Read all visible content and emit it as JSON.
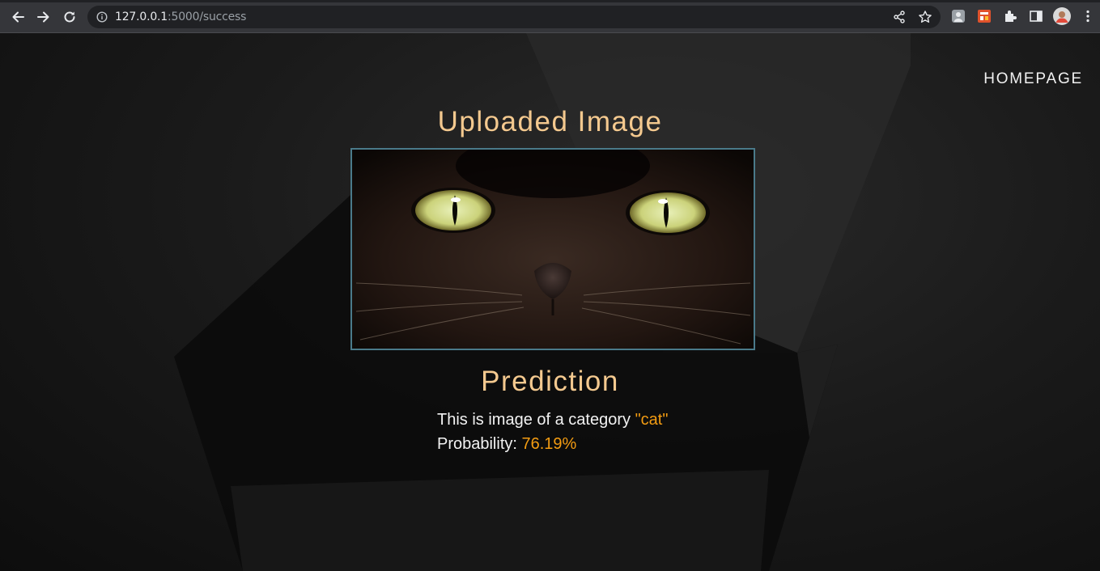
{
  "browser": {
    "url_host": "127.0.0.1",
    "url_path": ":5000/success"
  },
  "nav": {
    "homepage_label": "HOMEPAGE"
  },
  "upload": {
    "heading": "Uploaded Image"
  },
  "prediction": {
    "heading": "Prediction",
    "category_prefix": "This is image of a category ",
    "category_value": "\"cat\"",
    "probability_prefix": "Probability: ",
    "probability_value": "76.19%"
  },
  "colors": {
    "heading": "#f4c98f",
    "accent": "#f39c12",
    "image_border": "#4a7a8a"
  }
}
